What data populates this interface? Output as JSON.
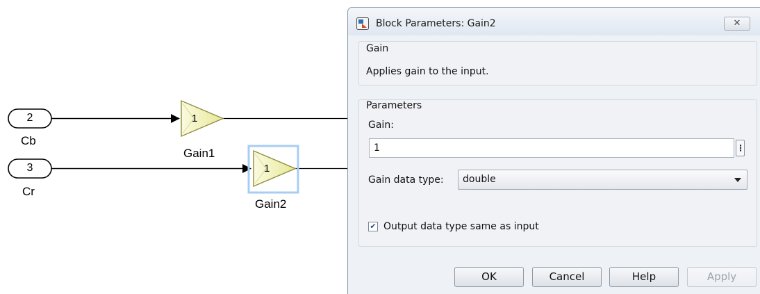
{
  "diagram": {
    "inports": [
      {
        "number": "2",
        "name": "Cb"
      },
      {
        "number": "3",
        "name": "Cr"
      }
    ],
    "gains": [
      {
        "value": "1",
        "name": "Gain1"
      },
      {
        "value": "1",
        "name": "Gain2"
      }
    ]
  },
  "dialog": {
    "title": "Block Parameters: Gain2",
    "close_icon": "close-icon",
    "description_group": {
      "title": "Gain",
      "text": "Applies gain to the input."
    },
    "parameters_group": {
      "title": "Parameters",
      "gain_label": "Gain:",
      "gain_value": "1",
      "data_type_label": "Gain data type:",
      "data_type_value": "double",
      "checkbox_label": "Output data type same as input",
      "checkbox_checked": true
    },
    "buttons": {
      "ok": "OK",
      "cancel": "Cancel",
      "help": "Help",
      "apply": "Apply"
    }
  }
}
